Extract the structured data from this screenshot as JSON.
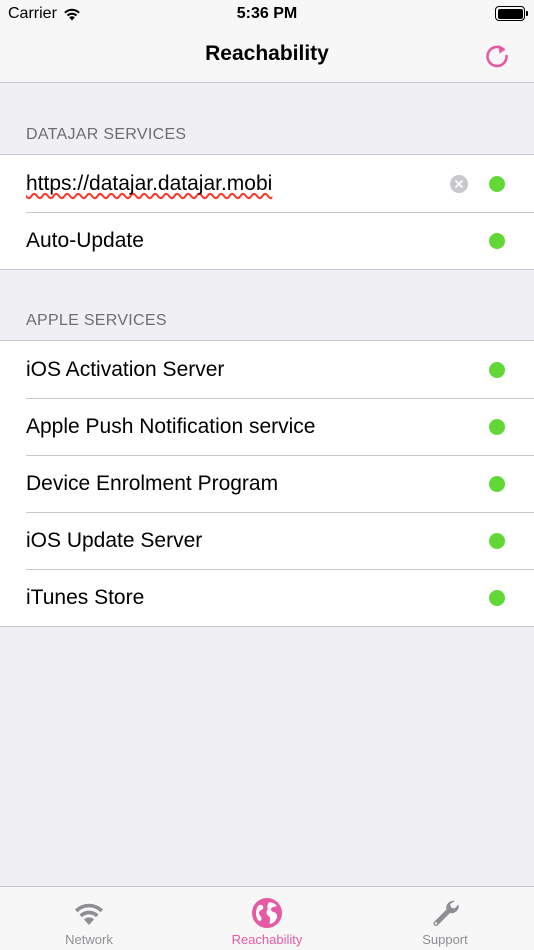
{
  "status_bar": {
    "carrier": "Carrier",
    "time": "5:36 PM"
  },
  "nav": {
    "title": "Reachability",
    "refresh_icon": "refresh-icon"
  },
  "sections": {
    "datajar": {
      "header": "DATAJAR SERVICES",
      "url_value": "https://datajar.datajar.mobi",
      "auto_update_label": "Auto-Update"
    },
    "apple": {
      "header": "APPLE SERVICES",
      "items": [
        "iOS Activation Server",
        "Apple Push Notification service",
        "Device Enrolment Program",
        "iOS Update Server",
        "iTunes Store"
      ]
    }
  },
  "tabs": [
    {
      "label": "Network",
      "icon": "wifi-icon"
    },
    {
      "label": "Reachability",
      "icon": "globe-icon"
    },
    {
      "label": "Support",
      "icon": "wrench-icon"
    }
  ],
  "colors": {
    "accent": "#e65aa5",
    "status_ok": "#61d836",
    "background": "#efeff4"
  }
}
